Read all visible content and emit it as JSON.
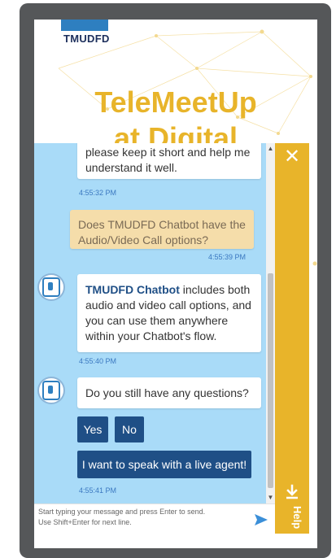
{
  "brand": {
    "logo_text": "TMUDFD",
    "hero_title": "TeleMeetUp",
    "hero_sub": "at Digital"
  },
  "chat": {
    "messages": [
      {
        "type": "bot",
        "text": "please keep it short and help me understand it well.",
        "time": "4:55:32 PM"
      },
      {
        "type": "user",
        "text": "Does TMUDFD Chatbot have the Audio/Video Call options?",
        "time": "4:55:39 PM"
      },
      {
        "type": "bot",
        "bot_name": "TMUDFD Chatbot",
        "text": " includes both audio and video call options, and you can use them anywhere within your Chatbot's flow.",
        "time": "4:55:40 PM"
      },
      {
        "type": "bot",
        "text": "Do you still have any questions?",
        "time": "4:55:41 PM"
      }
    ],
    "quick_replies": {
      "yes": "Yes",
      "no": "No",
      "live_agent": "I want to speak with a live agent!"
    }
  },
  "input": {
    "placeholder_line1": "Start typing your message and press Enter to send.",
    "placeholder_line2": "Use Shift+Enter for next line."
  },
  "side_panel": {
    "close_icon": "close-icon",
    "help_label": "Help"
  },
  "colors": {
    "accent": "#e8b42a",
    "chat_bg": "#a9dbf8",
    "button": "#1f4f86",
    "user_bubble": "#f5ddaa"
  }
}
